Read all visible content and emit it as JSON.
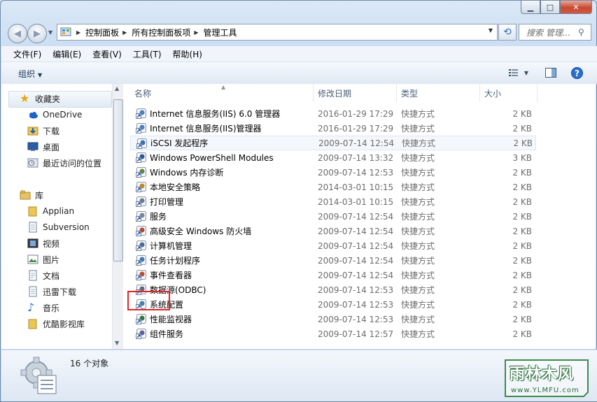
{
  "window": {
    "caption_min": "▁",
    "caption_max": "□",
    "caption_close": "✕"
  },
  "address": {
    "crumbs": [
      "控制面板",
      "所有控制面板项",
      "管理工具"
    ]
  },
  "search": {
    "placeholder": "搜索 管理..."
  },
  "menu": [
    "文件(F)",
    "编辑(E)",
    "查看(V)",
    "工具(T)",
    "帮助(H)"
  ],
  "toolbar": {
    "organize_label": "组织"
  },
  "nav": {
    "favorites_label": "收藏夹",
    "favorites": [
      "OneDrive",
      "下载",
      "桌面",
      "最近访问的位置"
    ],
    "libraries_label": "库",
    "libraries": [
      "Applian",
      "Subversion",
      "视频",
      "图片",
      "文档",
      "迅雷下载",
      "音乐",
      "优酷影视库"
    ]
  },
  "columns": {
    "name": "名称",
    "date": "修改日期",
    "type": "类型",
    "size": "大小"
  },
  "files": [
    {
      "name": "Internet 信息服务(IIS) 6.0 管理器",
      "date": "2016-01-29 17:29",
      "type": "快捷方式",
      "size": "2 KB",
      "icon": "iis6-icon"
    },
    {
      "name": "Internet 信息服务(IIS)管理器",
      "date": "2016-01-29 17:29",
      "type": "快捷方式",
      "size": "2 KB",
      "icon": "iis-icon"
    },
    {
      "name": "iSCSI 发起程序",
      "date": "2009-07-14 12:54",
      "type": "快捷方式",
      "size": "2 KB",
      "icon": "iscsi-icon"
    },
    {
      "name": "Windows PowerShell Modules",
      "date": "2009-07-14 13:32",
      "type": "快捷方式",
      "size": "3 KB",
      "icon": "powershell-icon"
    },
    {
      "name": "Windows 内存诊断",
      "date": "2009-07-14 12:53",
      "type": "快捷方式",
      "size": "2 KB",
      "icon": "memory-diagnostic-icon"
    },
    {
      "name": "本地安全策略",
      "date": "2014-03-01 10:15",
      "type": "快捷方式",
      "size": "2 KB",
      "icon": "security-policy-icon"
    },
    {
      "name": "打印管理",
      "date": "2014-03-01 10:15",
      "type": "快捷方式",
      "size": "2 KB",
      "icon": "printer-icon"
    },
    {
      "name": "服务",
      "date": "2009-07-14 12:54",
      "type": "快捷方式",
      "size": "2 KB",
      "icon": "services-gear-icon"
    },
    {
      "name": "高级安全 Windows 防火墙",
      "date": "2009-07-14 12:54",
      "type": "快捷方式",
      "size": "2 KB",
      "icon": "firewall-icon"
    },
    {
      "name": "计算机管理",
      "date": "2009-07-14 12:54",
      "type": "快捷方式",
      "size": "2 KB",
      "icon": "computer-management-icon"
    },
    {
      "name": "任务计划程序",
      "date": "2009-07-14 12:54",
      "type": "快捷方式",
      "size": "2 KB",
      "icon": "task-scheduler-icon"
    },
    {
      "name": "事件查看器",
      "date": "2009-07-14 12:54",
      "type": "快捷方式",
      "size": "2 KB",
      "icon": "event-viewer-icon"
    },
    {
      "name": "数据源(ODBC)",
      "date": "2009-07-14 12:53",
      "type": "快捷方式",
      "size": "2 KB",
      "icon": "odbc-icon"
    },
    {
      "name": "系统配置",
      "date": "2009-07-14 12:53",
      "type": "快捷方式",
      "size": "2 KB",
      "icon": "system-config-icon"
    },
    {
      "name": "性能监视器",
      "date": "2009-07-14 12:53",
      "type": "快捷方式",
      "size": "2 KB",
      "icon": "performance-monitor-icon"
    },
    {
      "name": "组件服务",
      "date": "2009-07-14 12:57",
      "type": "快捷方式",
      "size": "2 KB",
      "icon": "component-services-icon"
    }
  ],
  "status": {
    "count": "16 个对象"
  },
  "watermark": {
    "brand": "雨林木风",
    "url": "www.YLMFU.com"
  }
}
